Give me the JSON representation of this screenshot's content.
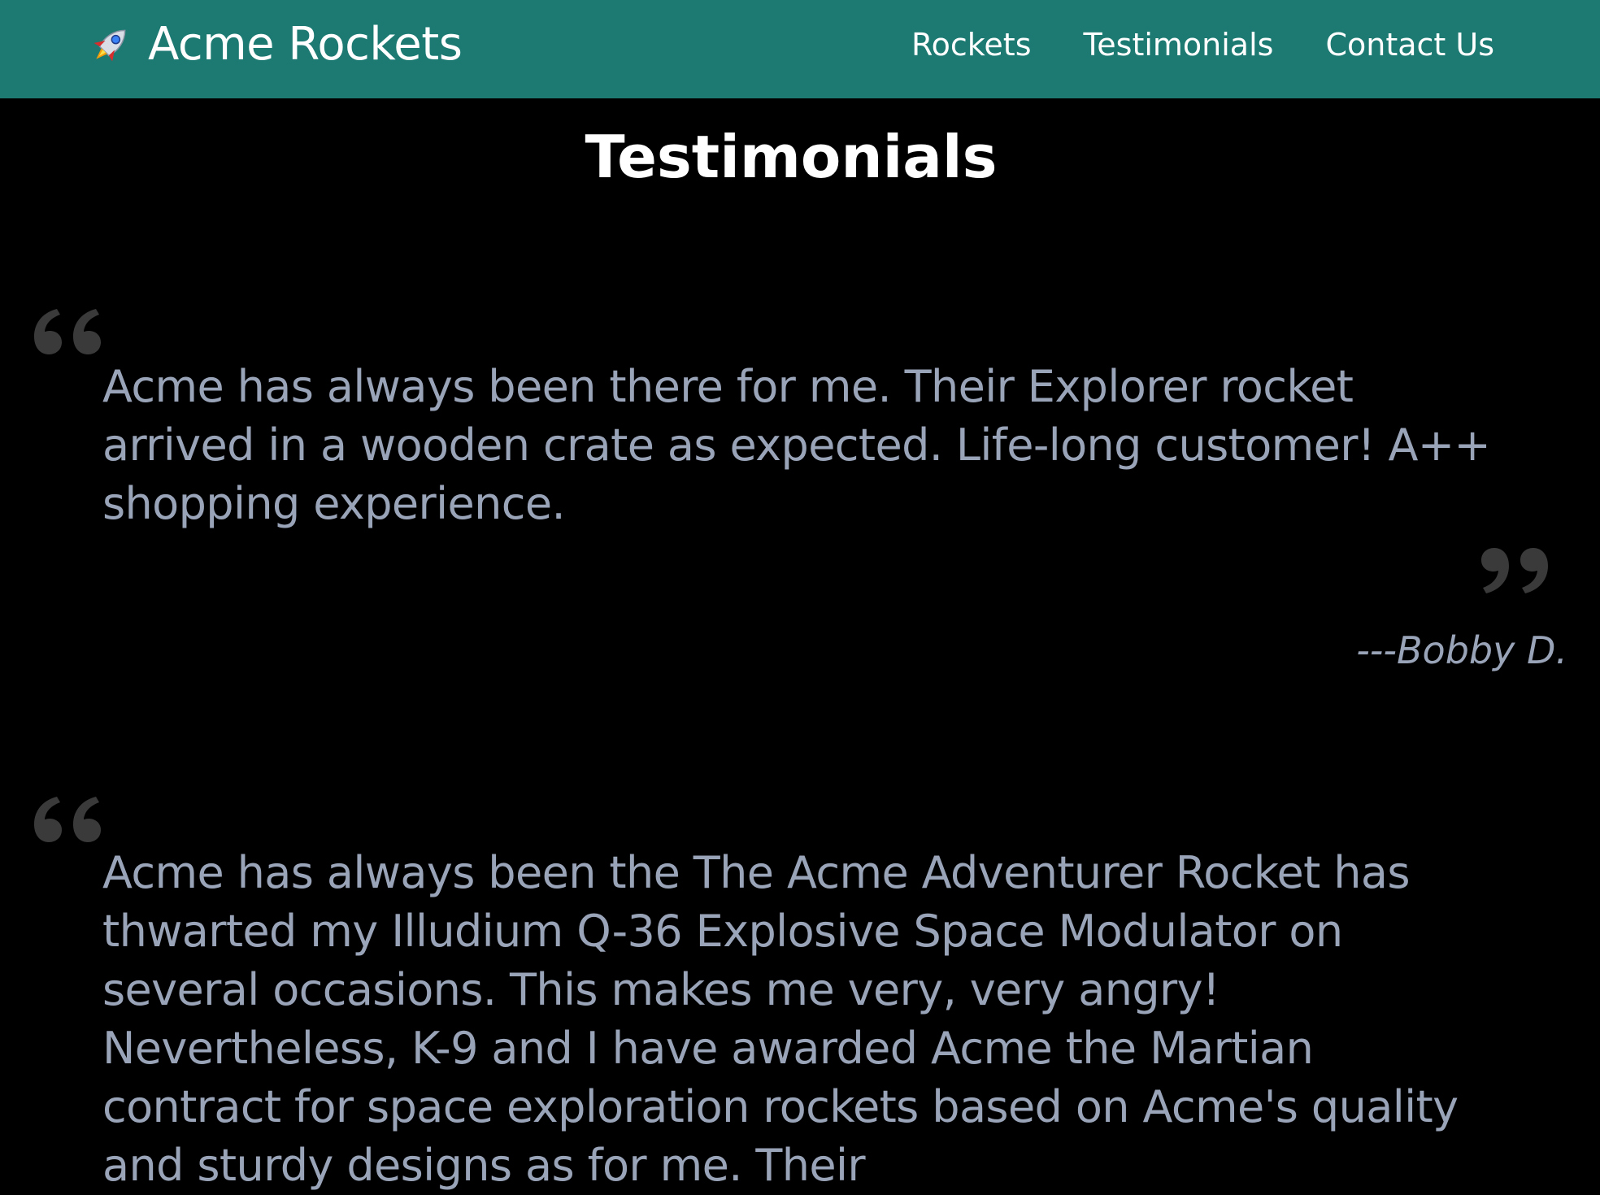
{
  "header": {
    "brand": "Acme Rockets",
    "brand_icon": "rocket-icon",
    "background": "#1c7a72",
    "nav": [
      {
        "label": "Rockets"
      },
      {
        "label": "Testimonials"
      },
      {
        "label": "Contact Us"
      }
    ]
  },
  "main": {
    "title": "Testimonials",
    "testimonials": [
      {
        "text": "Acme has always been there for me. Their Explorer rocket arrived in a wooden crate as expected. Life-long customer! A++ shopping experience.",
        "author": "---Bobby D."
      },
      {
        "text": "Acme has always been the The Acme Adventurer Rocket has thwarted my Illudium Q-36 Explosive Space Modulator on several occasions. This makes me very, very angry! Nevertheless, K-9 and I have awarded Acme the Martian contract for space exploration rockets based on Acme's quality and sturdy designs as for me. Their"
      }
    ]
  },
  "colors": {
    "background": "#000000",
    "quote_text": "#9aa4b8",
    "quote_mark": "#3a3a3a"
  }
}
